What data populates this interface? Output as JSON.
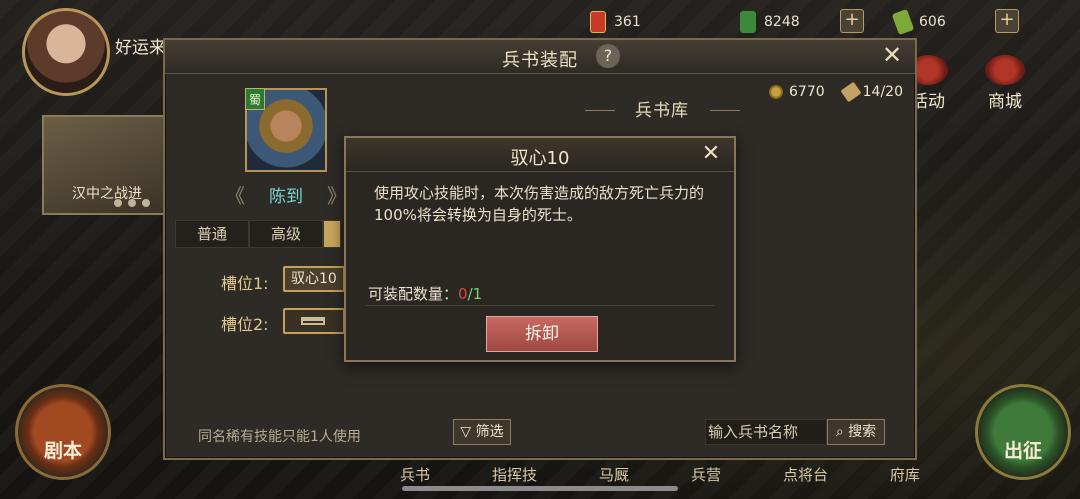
{
  "top_bar": {
    "player_name": "好运来暖暖好运来",
    "resources": [
      {
        "name": "gold-token",
        "value": "361"
      },
      {
        "name": "jade",
        "value": "8248"
      },
      {
        "name": "food",
        "value": "606"
      }
    ],
    "plus_label": "+"
  },
  "right_menu": {
    "activity_label": "活动",
    "city_label": "商城"
  },
  "campaign": {
    "label": "汉中之战进"
  },
  "buttons": {
    "script_label": "剧本",
    "march_label": "出征"
  },
  "bottom_nav": [
    "兵书",
    "指挥技",
    "马厩",
    "兵营",
    "点将台",
    "府库"
  ],
  "panel": {
    "title": "兵书装配",
    "help": "?",
    "close": "✕",
    "general": {
      "kingdom": "蜀",
      "name": "陈到"
    },
    "tabs": [
      "普通",
      "高级",
      ""
    ],
    "slots": [
      {
        "label": "槽位1:",
        "value": "驭心10"
      },
      {
        "label": "槽位2:",
        "value": ""
      }
    ],
    "coins": "6770",
    "capacity": "14/20",
    "library_title": "兵书库",
    "footer_note": "同名稀有技能只能1人使用",
    "filter_label": "筛选",
    "search_placeholder": "输入兵书名称",
    "search_label": "搜索"
  },
  "dialog": {
    "title": "驭心10",
    "close": "✕",
    "description": "使用攻心技能时，本次伤害造成的敌方死亡兵力的100%将会转换为自身的死士。",
    "count_label": "可装配数量：",
    "count_current": "0",
    "count_sep": "/",
    "count_max": "1",
    "unequip_label": "拆卸"
  },
  "colors": {
    "accent_gold": "#c9a55b",
    "general_name": "#79d5d0",
    "unequip_button": "#b85a52",
    "count_current": "#e2453a",
    "count_max": "#7bd36a"
  }
}
